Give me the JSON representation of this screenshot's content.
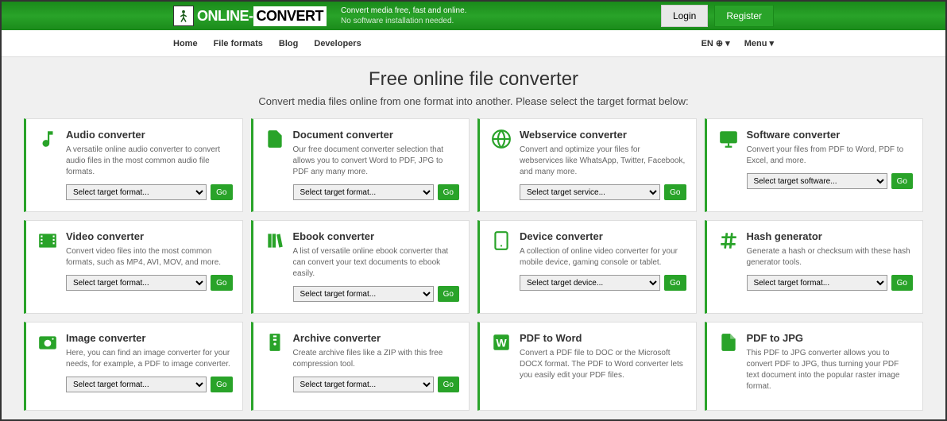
{
  "header": {
    "logo_part1": "ONLINE-",
    "logo_part2": "CONVERT",
    "tagline_main": "Convert media free, fast and online.",
    "tagline_sub": "No software installation needed.",
    "login": "Login",
    "register": "Register"
  },
  "nav": {
    "items": [
      "Home",
      "File formats",
      "Blog",
      "Developers"
    ],
    "lang": "EN ⊕ ▾",
    "menu": "Menu ▾"
  },
  "hero": {
    "title": "Free online file converter",
    "subtitle": "Convert media files online from one format into another. Please select the target format below:"
  },
  "cards": [
    {
      "icon": "music",
      "title": "Audio converter",
      "desc": "A versatile online audio converter to convert audio files in the most common audio file formats.",
      "select": "Select target format...",
      "go": "Go",
      "has_select": true
    },
    {
      "icon": "doc",
      "title": "Document converter",
      "desc": "Our free document converter selection that allows you to convert Word to PDF, JPG to PDF any many more.",
      "select": "Select target format...",
      "go": "Go",
      "has_select": true
    },
    {
      "icon": "globe",
      "title": "Webservice converter",
      "desc": "Convert and optimize your files for webservices like WhatsApp, Twitter, Facebook, and many more.",
      "select": "Select target service...",
      "go": "Go",
      "has_select": true
    },
    {
      "icon": "monitor",
      "title": "Software converter",
      "desc": "Convert your files from PDF to Word, PDF to Excel, and more.",
      "select": "Select target software...",
      "go": "Go",
      "has_select": true
    },
    {
      "icon": "film",
      "title": "Video converter",
      "desc": "Convert video files into the most common formats, such as MP4, AVI, MOV, and more.",
      "select": "Select target format...",
      "go": "Go",
      "has_select": true
    },
    {
      "icon": "books",
      "title": "Ebook converter",
      "desc": "A list of versatile online ebook converter that can convert your text documents to ebook easily.",
      "select": "Select target format...",
      "go": "Go",
      "has_select": true
    },
    {
      "icon": "tablet",
      "title": "Device converter",
      "desc": "A collection of online video converter for your mobile device, gaming console or tablet.",
      "select": "Select target device...",
      "go": "Go",
      "has_select": true
    },
    {
      "icon": "hash",
      "title": "Hash generator",
      "desc": "Generate a hash or checksum with these hash generator tools.",
      "select": "Select target format...",
      "go": "Go",
      "has_select": true
    },
    {
      "icon": "camera",
      "title": "Image converter",
      "desc": "Here, you can find an image converter for your needs, for example, a PDF to image converter.",
      "select": "Select target format...",
      "go": "Go",
      "has_select": true
    },
    {
      "icon": "zip",
      "title": "Archive converter",
      "desc": "Create archive files like a ZIP with this free compression tool.",
      "select": "Select target format...",
      "go": "Go",
      "has_select": true
    },
    {
      "icon": "word",
      "title": "PDF to Word",
      "desc": "Convert a PDF file to DOC or the Microsoft DOCX format. The PDF to Word converter lets you easily edit your PDF files.",
      "select": "",
      "go": "",
      "has_select": false
    },
    {
      "icon": "jpg",
      "title": "PDF to JPG",
      "desc": "This PDF to JPG converter allows you to convert PDF to JPG, thus turning your PDF text document into the popular raster image format.",
      "select": "",
      "go": "",
      "has_select": false
    }
  ]
}
